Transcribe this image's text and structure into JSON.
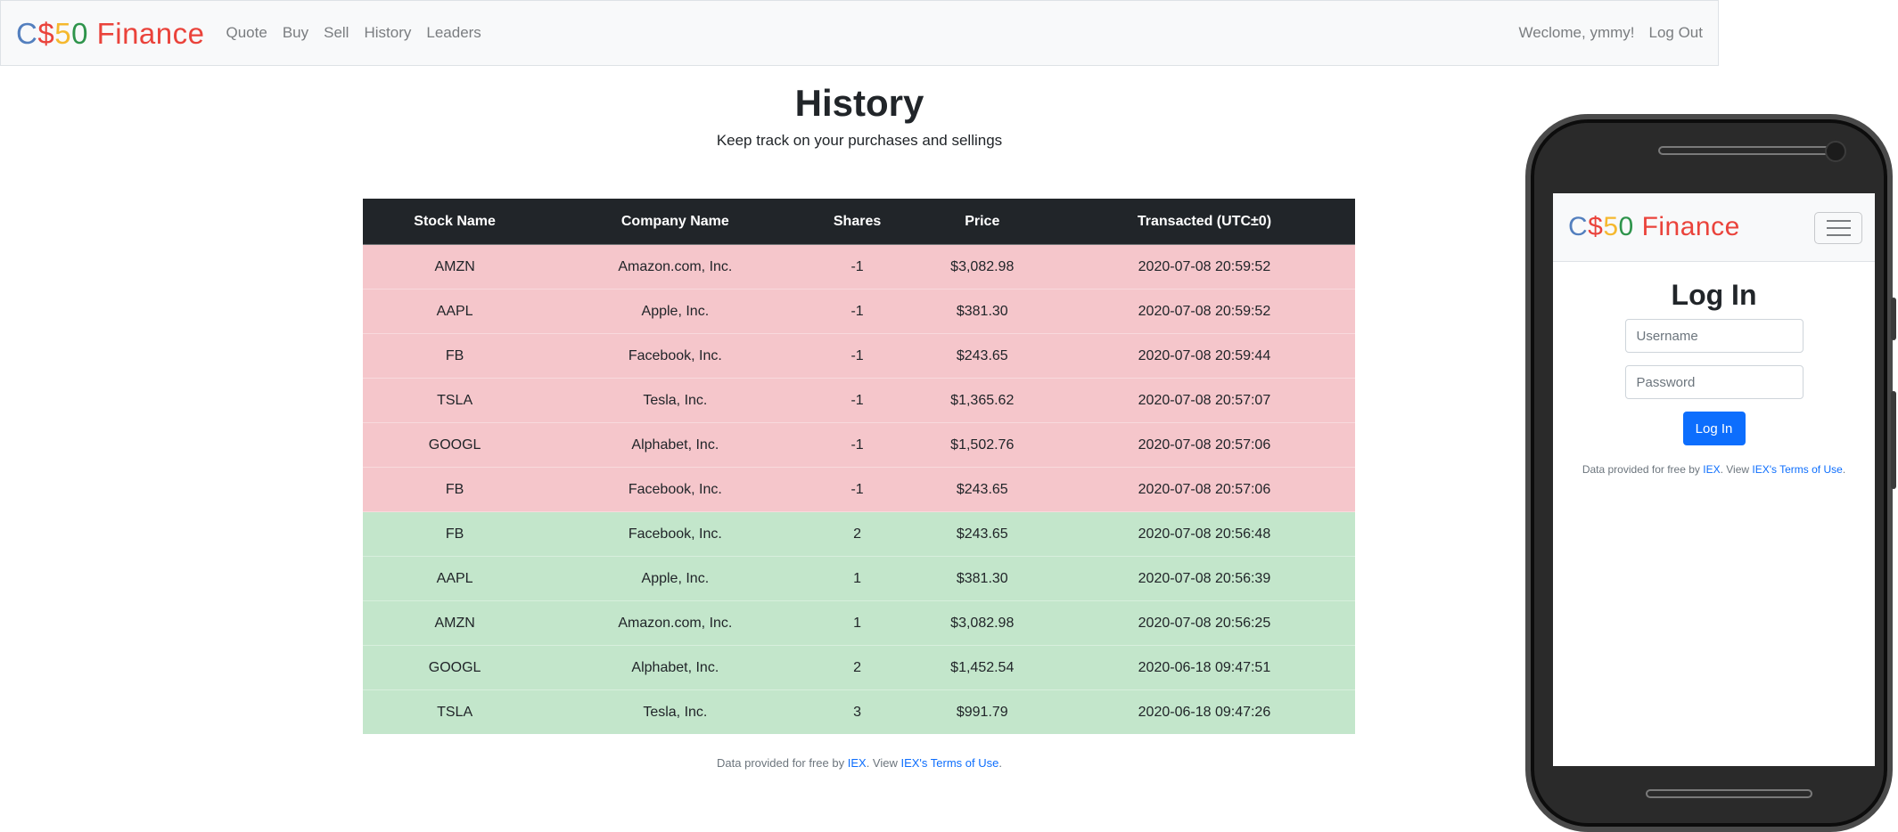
{
  "brand": {
    "parts": [
      {
        "text": "C",
        "color": "#537fbe"
      },
      {
        "text": "$",
        "color": "#ea433b"
      },
      {
        "text": "5",
        "color": "#f5b82e"
      },
      {
        "text": "0",
        "color": "#2e944b"
      },
      {
        "text": " Finance",
        "color": "#ea433b"
      }
    ]
  },
  "nav": {
    "quote": "Quote",
    "buy": "Buy",
    "sell": "Sell",
    "history": "History",
    "leaders": "Leaders",
    "welcome": "Weclome, ymmy!",
    "logout": "Log Out"
  },
  "page": {
    "title": "History",
    "subtitle": "Keep track on your purchases and sellings"
  },
  "table": {
    "headers": [
      "Stock Name",
      "Company Name",
      "Shares",
      "Price",
      "Transacted (UTC±0)"
    ],
    "rows": [
      {
        "type": "sell",
        "cells": [
          "AMZN",
          "Amazon.com, Inc.",
          "-1",
          "$3,082.98",
          "2020-07-08 20:59:52"
        ]
      },
      {
        "type": "sell",
        "cells": [
          "AAPL",
          "Apple, Inc.",
          "-1",
          "$381.30",
          "2020-07-08 20:59:52"
        ]
      },
      {
        "type": "sell",
        "cells": [
          "FB",
          "Facebook, Inc.",
          "-1",
          "$243.65",
          "2020-07-08 20:59:44"
        ]
      },
      {
        "type": "sell",
        "cells": [
          "TSLA",
          "Tesla, Inc.",
          "-1",
          "$1,365.62",
          "2020-07-08 20:57:07"
        ]
      },
      {
        "type": "sell",
        "cells": [
          "GOOGL",
          "Alphabet, Inc.",
          "-1",
          "$1,502.76",
          "2020-07-08 20:57:06"
        ]
      },
      {
        "type": "sell",
        "cells": [
          "FB",
          "Facebook, Inc.",
          "-1",
          "$243.65",
          "2020-07-08 20:57:06"
        ]
      },
      {
        "type": "buy",
        "cells": [
          "FB",
          "Facebook, Inc.",
          "2",
          "$243.65",
          "2020-07-08 20:56:48"
        ]
      },
      {
        "type": "buy",
        "cells": [
          "AAPL",
          "Apple, Inc.",
          "1",
          "$381.30",
          "2020-07-08 20:56:39"
        ]
      },
      {
        "type": "buy",
        "cells": [
          "AMZN",
          "Amazon.com, Inc.",
          "1",
          "$3,082.98",
          "2020-07-08 20:56:25"
        ]
      },
      {
        "type": "buy",
        "cells": [
          "GOOGL",
          "Alphabet, Inc.",
          "2",
          "$1,452.54",
          "2020-06-18 09:47:51"
        ]
      },
      {
        "type": "buy",
        "cells": [
          "TSLA",
          "Tesla, Inc.",
          "3",
          "$991.79",
          "2020-06-18 09:47:26"
        ]
      }
    ]
  },
  "footer": {
    "prefix": "Data provided for free by ",
    "iex_link": "IEX",
    "middle": ". View ",
    "terms_link": "IEX's Terms of Use",
    "suffix": "."
  },
  "mobile": {
    "title": "Log In",
    "username_placeholder": "Username",
    "password_placeholder": "Password",
    "login_button": "Log In"
  },
  "colors": {
    "sell_row": "#f5c6cb",
    "buy_row": "#c3e6cb",
    "table_header": "#212529",
    "primary": "#0d6efd"
  }
}
